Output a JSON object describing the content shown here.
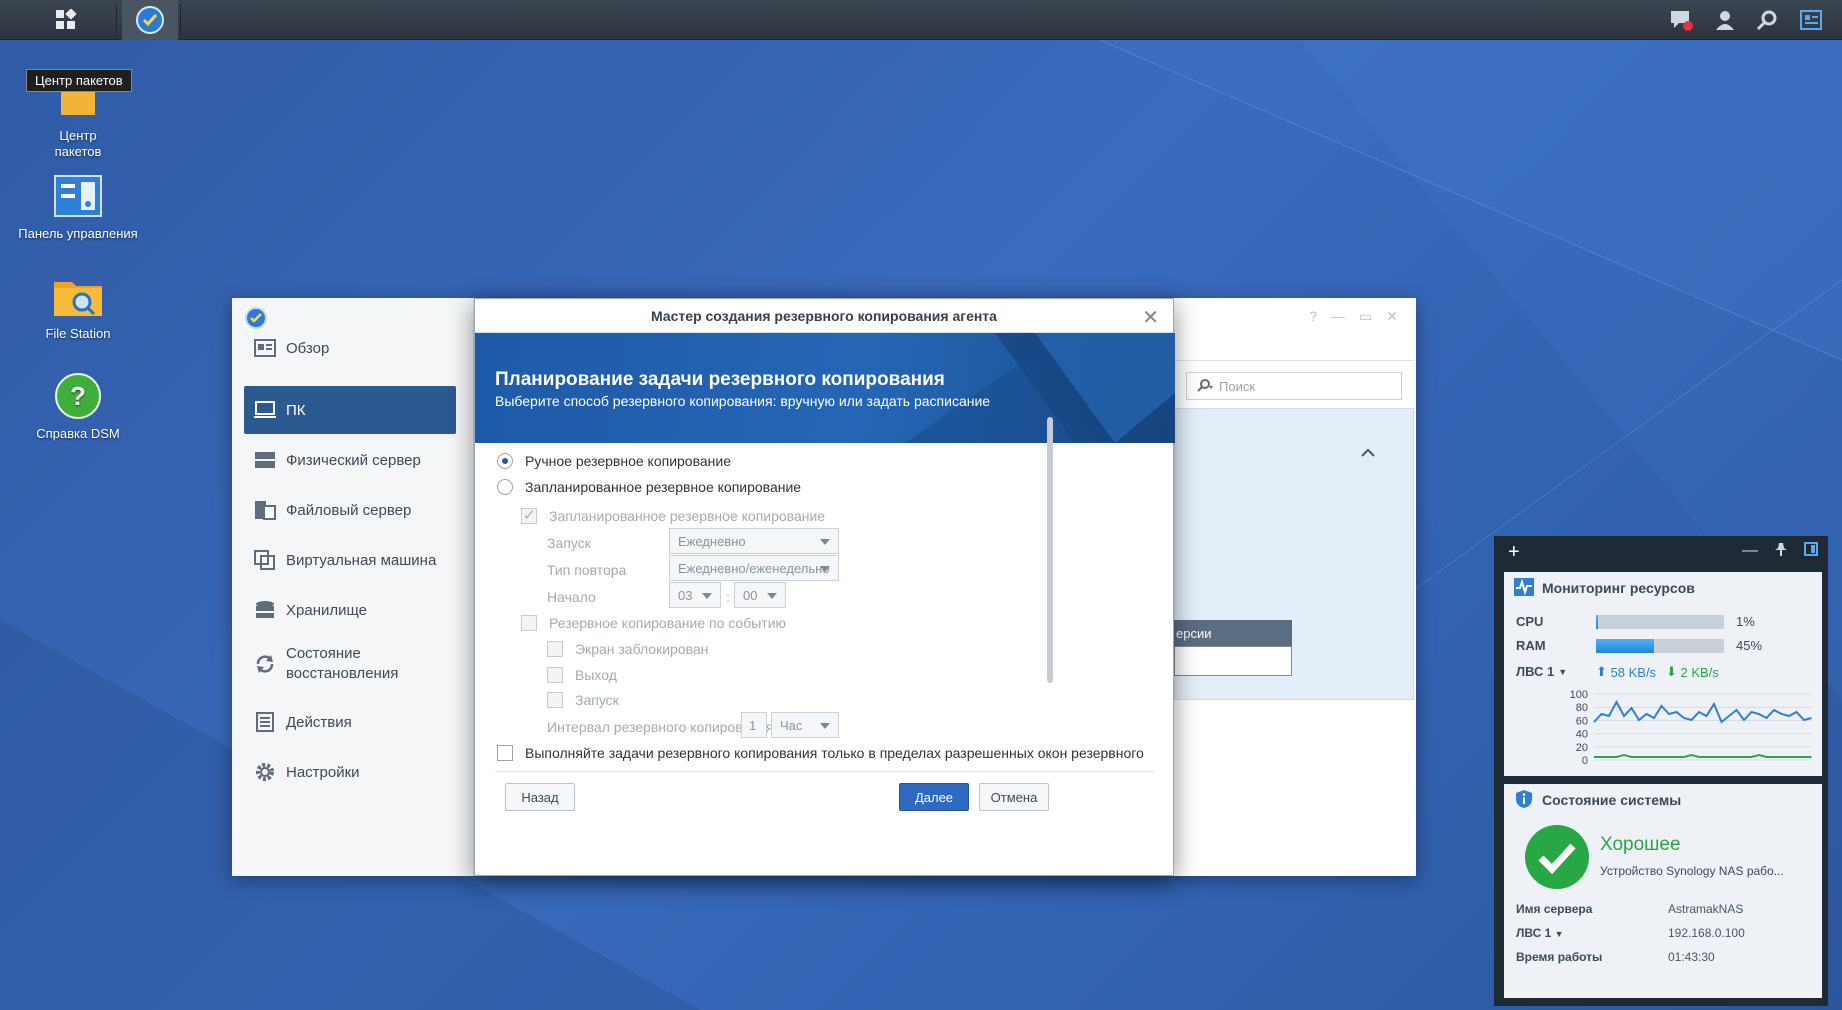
{
  "taskbar": {
    "left_icons": [
      "apps-grid-icon",
      "active-backup-icon"
    ],
    "right_icons": [
      "chat-notification-icon",
      "user-icon",
      "search-icon",
      "widgets-icon"
    ]
  },
  "tooltip": "Центр пакетов",
  "desktop": [
    {
      "label": "Центр\nпакетов",
      "line1": "Центр",
      "line2": "пакетов",
      "icon": "package-center-icon"
    },
    {
      "label": "Панель управления",
      "icon": "control-panel-icon"
    },
    {
      "label": "File Station",
      "icon": "file-station-icon"
    },
    {
      "label": "Справка DSM",
      "icon": "dsm-help-icon"
    }
  ],
  "app": {
    "sidebar": [
      {
        "label": "Обзор",
        "icon": "overview-icon"
      },
      {
        "label": "ПК",
        "icon": "pc-icon",
        "active": true
      },
      {
        "label": "Физический сервер",
        "icon": "server-icon"
      },
      {
        "label": "Файловый сервер",
        "icon": "file-server-icon"
      },
      {
        "label": "Виртуальная машина",
        "icon": "vm-icon"
      },
      {
        "label": "Хранилище",
        "icon": "storage-icon"
      },
      {
        "label": "Состояние",
        "label2": "восстановления",
        "icon": "restore-icon"
      },
      {
        "label": "Действия",
        "icon": "log-icon"
      },
      {
        "label": "Настройки",
        "icon": "settings-icon"
      }
    ],
    "search_placeholder": "Поиск",
    "tab_header_fragment": "ерсии",
    "window_controls": [
      "?",
      "—",
      "▭",
      "✕"
    ]
  },
  "dialog": {
    "title": "Мастер создания резервного копирования агента",
    "banner_title": "Планирование задачи резервного копирования",
    "banner_subtitle": "Выберите способ резервного копирования: вручную или задать расписание",
    "manual": "Ручное резервное копирование",
    "scheduled": "Запланированное резервное копирование",
    "scheduled_check": "Запланированное резервное копирование",
    "launch_label": "Запуск",
    "launch_value": "Ежедневно",
    "repeat_label": "Тип повтора",
    "repeat_value": "Ежедневно/еженедельно",
    "start_label": "Начало",
    "start_hour": "03",
    "start_sep": ":",
    "start_min": "00",
    "event_backup": "Резервное копирование по событию",
    "screen_locked": "Экран заблокирован",
    "logout": "Выход",
    "startup": "Запуск",
    "interval_label": "Интервал резервного копирования:",
    "interval_value": "1",
    "interval_unit": "Час",
    "window_only": "Выполняйте задачи резервного копирования только в пределах разрешенных окон резервного",
    "back": "Назад",
    "next": "Далее",
    "cancel": "Отмена",
    "close": "✕"
  },
  "widgets": {
    "add": "+",
    "resource": {
      "title": "Мониторинг ресурсов",
      "cpu_label": "CPU",
      "cpu_value": "1%",
      "cpu_fraction": 0.01,
      "ram_label": "RAM",
      "ram_value": "45%",
      "ram_fraction": 0.45,
      "lan_label": "ЛВС 1",
      "up": "58 KB/s",
      "down": "2 KB/s",
      "y_ticks": [
        "100",
        "80",
        "60",
        "40",
        "20",
        "0"
      ]
    },
    "status": {
      "title": "Состояние системы",
      "state": "Хорошее",
      "desc": "Устройство Synology NAS рабо...",
      "server_label": "Имя сервера",
      "server_value": "AstramakNAS",
      "lan_label": "ЛВС 1",
      "lan_value": "192.168.0.100",
      "uptime_label": "Время работы",
      "uptime_value": "01:43:30"
    }
  },
  "colors": {
    "accent": "#2b5a91",
    "primary_button": "#2e6bc0",
    "good": "#27a844"
  }
}
